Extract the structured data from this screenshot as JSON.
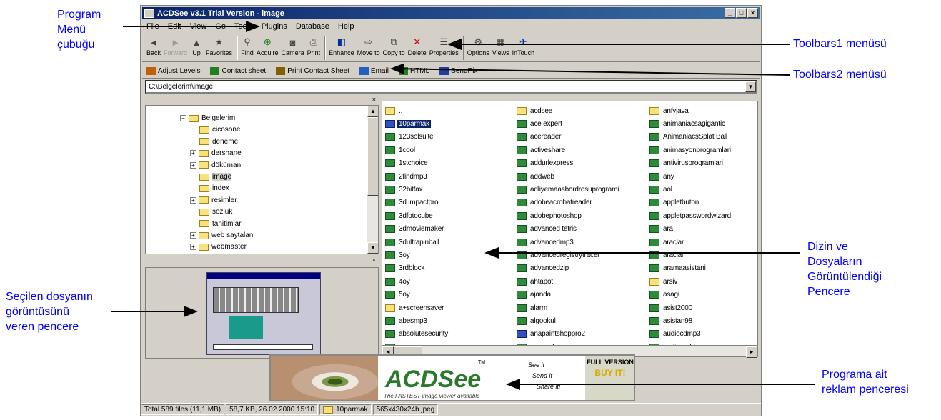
{
  "window": {
    "title": "ACDSee v3.1 Trial Version - image",
    "buttons": [
      "_",
      "□",
      "×"
    ]
  },
  "menubar": [
    "File",
    "Edit",
    "View",
    "Go",
    "Tools",
    "Plugins",
    "Database",
    "Help"
  ],
  "toolbar1": [
    {
      "label": "Back",
      "icon": "back-icon",
      "dim": false
    },
    {
      "label": "Forward",
      "icon": "forward-icon",
      "dim": true
    },
    {
      "label": "Up",
      "icon": "up-icon",
      "dim": false
    },
    {
      "label": "Favorites",
      "icon": "favorites-icon",
      "dim": false
    },
    {
      "label": "Find",
      "icon": "binoculars-icon",
      "dim": false
    },
    {
      "label": "Acquire",
      "icon": "acquire-icon",
      "dim": false
    },
    {
      "label": "Camera",
      "icon": "camera-icon",
      "dim": false
    },
    {
      "label": "Print",
      "icon": "printer-icon",
      "dim": false
    },
    {
      "label": "Enhance",
      "icon": "enhance-icon",
      "dim": false
    },
    {
      "label": "Move to",
      "icon": "move-icon",
      "dim": false
    },
    {
      "label": "Copy to",
      "icon": "copy-icon",
      "dim": false
    },
    {
      "label": "Delete",
      "icon": "delete-icon",
      "dim": false
    },
    {
      "label": "Properties",
      "icon": "properties-icon",
      "dim": false
    },
    {
      "label": "Options",
      "icon": "options-icon",
      "dim": false
    },
    {
      "label": "Views",
      "icon": "views-icon",
      "dim": false
    },
    {
      "label": "InTouch",
      "icon": "intouch-icon",
      "dim": false
    }
  ],
  "toolbar2": [
    "Adjust Levels",
    "Contact sheet",
    "Print Contact Sheet",
    "Email",
    "HTML",
    "SendPix"
  ],
  "address": "C:\\Belgelerim\\image",
  "tree": [
    {
      "label": "Belgelerim",
      "exp": "⊟"
    },
    {
      "label": "cicosone",
      "exp": ""
    },
    {
      "label": "deneme",
      "exp": ""
    },
    {
      "label": "dershane",
      "exp": "⊞"
    },
    {
      "label": "döküman",
      "exp": "⊞"
    },
    {
      "label": "image",
      "exp": ""
    },
    {
      "label": "index",
      "exp": ""
    },
    {
      "label": "resimler",
      "exp": "⊞"
    },
    {
      "label": "sozluk",
      "exp": ""
    },
    {
      "label": "tanitimlar",
      "exp": ""
    },
    {
      "label": "web saytalan",
      "exp": "⊞"
    },
    {
      "label": "webmaster",
      "exp": "⊞"
    }
  ],
  "files": {
    "col1": [
      "..",
      "10parmak",
      "123solsuite",
      "1cool",
      "1stchoice",
      "2findmp3",
      "32bitfax",
      "3d impactpro",
      "3dfotocube",
      "3dmoviemaker",
      "3dultrapinball",
      "3oy",
      "3rdblock",
      "4oy",
      "5oy",
      "a+screensaver",
      "abesmp3",
      "absolutesecurity",
      "accountpro"
    ],
    "col2": [
      "acdsee",
      "ace expert",
      "acereader",
      "activeshare",
      "addurlexpress",
      "addweb",
      "adliyemaasbordrosuprogrami",
      "adobeacrobatreader",
      "adobephotoshop",
      "advanced tetris",
      "advancedmp3",
      "advancedregistrytracer",
      "advancedzip",
      "ahtapot",
      "ajanda",
      "alarm",
      "algookul",
      "anapaintshoppro2",
      "anasayfa"
    ],
    "col3": [
      "anfyjava",
      "animaniacsagigantic",
      "AnimaniacsSplat Ball",
      "animasyonprogramlari",
      "antivirusprogramlari",
      "any",
      "aol",
      "appletbuton",
      "appletpasswordwizard",
      "ara",
      "araclar",
      "araclar",
      "aramaasistani",
      "arsiv",
      "asagi",
      "asist2000",
      "asistan98",
      "audiocdmp3",
      "audiograbber"
    ]
  },
  "ad": {
    "logo": "ACDSee",
    "slogan": "The FASTEST image viewer available",
    "tm": "TM",
    "lines": [
      "See it",
      "Send it",
      "Share it!"
    ],
    "full": "FULL VERSION",
    "buy": "BUY IT!"
  },
  "status": [
    "Total 589 files (11,1 MB)",
    "58,7 KB, 26.02.2000 15:10",
    "10parmak",
    "565x430x24b jpeg"
  ],
  "annotations": {
    "program_menu": [
      "Program",
      "Menü",
      "çubuğu"
    ],
    "toolbars1": "Toolbars1 menüsü",
    "toolbars2": "Toolbars2 menüsü",
    "dizin": [
      "Dizin ve",
      "Dosyaların",
      "Görüntülendiği",
      "Pencere"
    ],
    "secilen": [
      "Seçilen dosyanın",
      "görüntüsünü",
      "veren pencere"
    ],
    "reklam": [
      "Programa ait",
      "reklam penceresi"
    ]
  }
}
